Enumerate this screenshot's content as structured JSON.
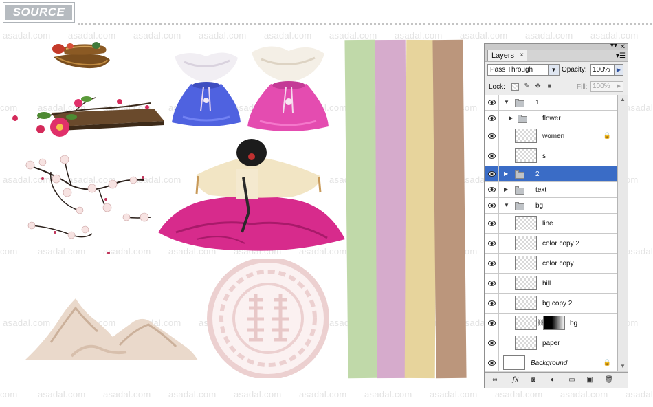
{
  "header": {
    "badge": "SOURCE"
  },
  "watermark": "asadal.com",
  "watermark_partial": "com",
  "colors": {
    "strips": [
      "#c0d9a9",
      "#d6abcc",
      "#e7d49c",
      "#bb967c"
    ]
  },
  "canvas_items": [
    "straw-shoes-image",
    "camellia-branch-image",
    "blue-pouch-image",
    "pink-pouch-image",
    "plum-blossom-image",
    "bowing-woman-hanbok-image",
    "mountain-ink-image",
    "korean-double-happiness-symbol"
  ],
  "layers_panel": {
    "tab_label": "Layers",
    "blend_mode": "Pass Through",
    "opacity_label": "Opacity:",
    "opacity_value": "100%",
    "lock_label": "Lock:",
    "fill_label": "Fill:",
    "fill_value": "100%",
    "layers": [
      {
        "name": "1",
        "kind": "group",
        "expanded": true,
        "indent": 0,
        "visible": true
      },
      {
        "name": "flower",
        "kind": "group",
        "expanded": false,
        "indent": 1,
        "visible": true
      },
      {
        "name": "women",
        "kind": "layer",
        "indent": 1,
        "visible": true,
        "locked": true
      },
      {
        "name": "s",
        "kind": "layer",
        "indent": 1,
        "visible": true
      },
      {
        "name": "2",
        "kind": "group",
        "expanded": false,
        "indent": 0,
        "visible": true,
        "selected": true
      },
      {
        "name": "text",
        "kind": "group",
        "expanded": false,
        "indent": 0,
        "visible": true
      },
      {
        "name": "bg",
        "kind": "group",
        "expanded": true,
        "indent": 0,
        "visible": true
      },
      {
        "name": "line",
        "kind": "layer",
        "indent": 1,
        "visible": true
      },
      {
        "name": "color copy 2",
        "kind": "layer",
        "indent": 1,
        "visible": true
      },
      {
        "name": "color copy",
        "kind": "layer",
        "indent": 1,
        "visible": true
      },
      {
        "name": "hill",
        "kind": "layer",
        "indent": 1,
        "visible": true
      },
      {
        "name": "bg copy 2",
        "kind": "layer",
        "indent": 1,
        "visible": true
      },
      {
        "name": "bg",
        "kind": "layer",
        "indent": 1,
        "visible": true,
        "mask": true
      },
      {
        "name": "paper",
        "kind": "layer",
        "indent": 1,
        "visible": true
      },
      {
        "name": "Background",
        "kind": "background",
        "indent": 0,
        "visible": true,
        "locked": true
      }
    ],
    "bottom_icons": [
      "link-icon",
      "fx-icon",
      "mask-icon",
      "adjustment-icon",
      "new-group-icon",
      "new-layer-icon",
      "trash-icon"
    ]
  }
}
